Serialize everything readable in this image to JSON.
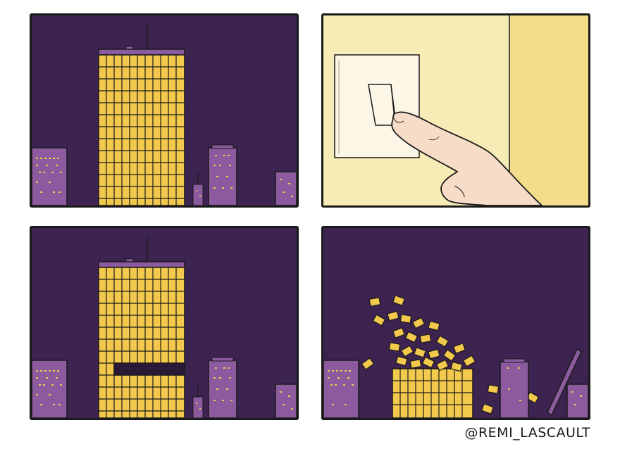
{
  "comic": {
    "credit": "@REMI_LASCAULT",
    "colors": {
      "night_sky": "#3d2350",
      "window_light": "#f2c94c",
      "building_purple": "#8c5a9e",
      "wall_cream": "#f8ecb6",
      "outline": "#1a1a1a"
    },
    "panels": [
      {
        "id": "panel-1",
        "scene": "skyscraper-lit"
      },
      {
        "id": "panel-2",
        "scene": "finger-pressing-light-switch"
      },
      {
        "id": "panel-3",
        "scene": "skyscraper-row-switched-off"
      },
      {
        "id": "panel-4",
        "scene": "windows-collapsing"
      }
    ]
  }
}
